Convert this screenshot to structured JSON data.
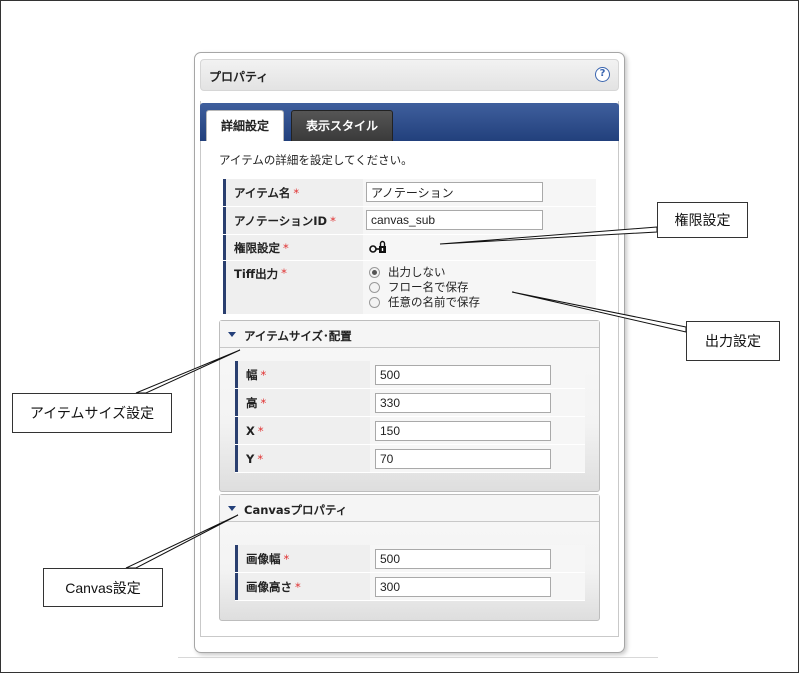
{
  "panel": {
    "title": "プロパティ",
    "help": "?"
  },
  "tabs": [
    {
      "label": "詳細設定",
      "active": true
    },
    {
      "label": "表示スタイル",
      "active": false
    }
  ],
  "description": "アイテムの詳細を設定してください。",
  "required_mark": "*",
  "fields": {
    "item_name": {
      "label": "アイテム名",
      "value": "アノテーション"
    },
    "annotation_id": {
      "label": "アノテーションID",
      "value": "canvas_sub"
    },
    "permission": {
      "label": "権限設定"
    },
    "tiff_output": {
      "label": "Tiff出力",
      "options": [
        "出力しない",
        "フロー名で保存",
        "任意の名前で保存"
      ],
      "selected": 0
    }
  },
  "item_size_section": {
    "title": "アイテムサイズ･配置",
    "fields": [
      {
        "label": "幅",
        "value": "500"
      },
      {
        "label": "高",
        "value": "330"
      },
      {
        "label": "X",
        "value": "150"
      },
      {
        "label": "Y",
        "value": "70"
      }
    ]
  },
  "canvas_section": {
    "title": "Canvasプロパティ",
    "fields": [
      {
        "label": "画像幅",
        "value": "500"
      },
      {
        "label": "画像高さ",
        "value": "300"
      }
    ]
  },
  "callouts": {
    "permission": "権限設定",
    "output": "出力設定",
    "item_size": "アイテムサイズ設定",
    "canvas": "Canvas設定"
  },
  "colors": {
    "tab_bar": "#2d4b8a",
    "label_bar": "#2a3f6f",
    "required": "#e03030",
    "help": "#3b66b0"
  }
}
